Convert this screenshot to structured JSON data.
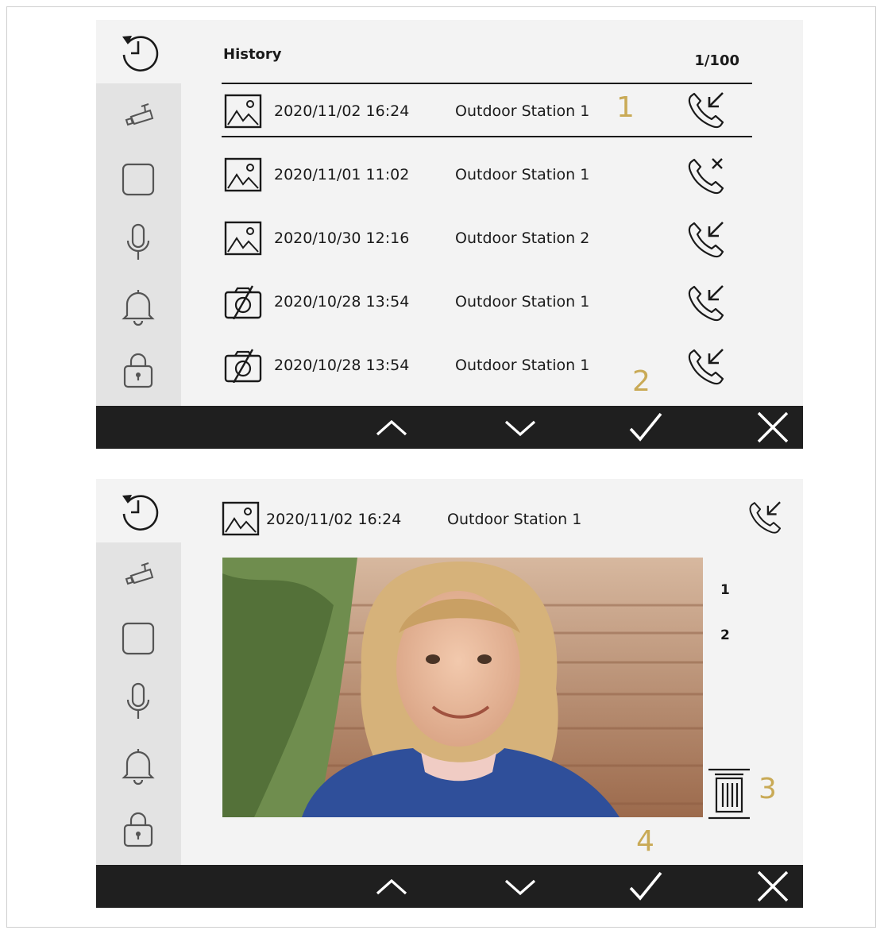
{
  "list_screen": {
    "title": "History",
    "page_count": "1/100",
    "rows": [
      {
        "thumbnail": "image-icon",
        "date": "2020/11/02 16:24",
        "station": "Outdoor Station 1",
        "call_type": "incoming-call-icon",
        "selected": true
      },
      {
        "thumbnail": "image-icon",
        "date": "2020/11/01 11:02",
        "station": "Outdoor Station 1",
        "call_type": "missed-call-icon",
        "selected": false
      },
      {
        "thumbnail": "image-icon",
        "date": "2020/10/30 12:16",
        "station": "Outdoor Station 2",
        "call_type": "incoming-call-icon",
        "selected": false
      },
      {
        "thumbnail": "no-image-icon",
        "date": "2020/10/28 13:54",
        "station": "Outdoor Station 1",
        "call_type": "incoming-call-icon",
        "selected": false
      },
      {
        "thumbnail": "no-image-icon",
        "date": "2020/10/28 13:54",
        "station": "Outdoor Station 1",
        "call_type": "incoming-call-icon",
        "selected": false
      }
    ],
    "callouts": [
      "1",
      "2"
    ]
  },
  "detail_screen": {
    "thumbnail": "image-icon",
    "date": "2020/11/02 16:24",
    "station": "Outdoor Station 1",
    "call_type": "incoming-call-icon",
    "photo": "visitor-snapshot-girl",
    "image_indexes": [
      "1",
      "2"
    ],
    "callouts": [
      "3",
      "4"
    ]
  },
  "sidebar_icons": [
    "history-icon",
    "camera-icon",
    "square-icon",
    "microphone-icon",
    "bell-icon",
    "lock-icon"
  ],
  "bottom_bar_icons": [
    "chevron-up-icon",
    "chevron-down-icon",
    "checkmark-icon",
    "close-icon"
  ],
  "colors": {
    "screen_bg": "#f3f3f3",
    "sidebar_bg": "#e3e3e3",
    "bar_bg": "#1f1f1f",
    "callout": "#c9aa56"
  }
}
